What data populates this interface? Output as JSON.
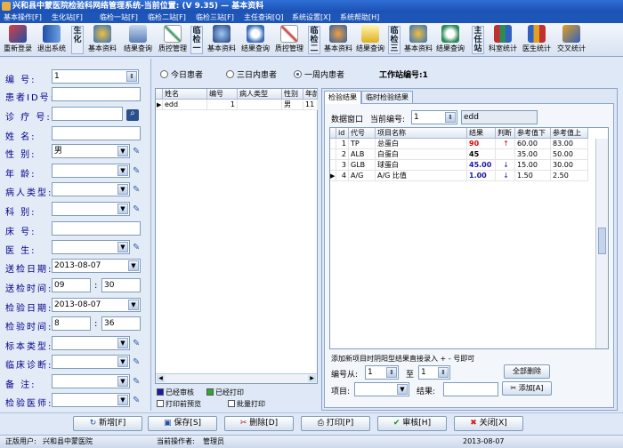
{
  "window": {
    "title": "兴和县中蒙医院检验科网络管理系统-当前位置:  (V 9.35) — 基本资料"
  },
  "menu": [
    "基本操作[F]",
    "生化站[F]",
    "临检一站[F]",
    "临检二站[F]",
    "临检三站[F]",
    "主任查询[Q]",
    "系统设置[X]",
    "系统帮助[H]"
  ],
  "toolbar": {
    "items": [
      "重新登录",
      "退出系统",
      "基本资料",
      "结果查询",
      "质控管理",
      "基本资料",
      "结果查询",
      "质控管理",
      "基本资料",
      "结果查询",
      "基本资料",
      "结果查询",
      "科室统计",
      "医生统计",
      "交叉统计"
    ],
    "vlabels": [
      "生化",
      "临检一",
      "临检二",
      "临检三",
      "主任站"
    ]
  },
  "form": {
    "fields": [
      {
        "label": "编  号:",
        "value": "1"
      },
      {
        "label": "患者ID号:",
        "value": ""
      },
      {
        "label": "诊 疗 号:",
        "value": ""
      },
      {
        "label": "姓   名:",
        "value": ""
      },
      {
        "label": "性   别:",
        "value": "男"
      },
      {
        "label": "年   龄:",
        "value": ""
      },
      {
        "label": "病人类型:",
        "value": ""
      },
      {
        "label": "科   别:",
        "value": ""
      },
      {
        "label": "床   号:",
        "value": ""
      },
      {
        "label": "医   生:",
        "value": ""
      },
      {
        "label": "送检日期:",
        "value": "2013-08-07"
      },
      {
        "label": "送检时间:",
        "value": "09",
        "value2": "30"
      },
      {
        "label": "检验日期:",
        "value": "2013-08-07"
      },
      {
        "label": "检验时间:",
        "value": "8",
        "value2": "36"
      },
      {
        "label": "标本类型:",
        "value": ""
      },
      {
        "label": "临床诊断:",
        "value": ""
      },
      {
        "label": "备   注:",
        "value": ""
      },
      {
        "label": "检验医师:",
        "value": ""
      }
    ]
  },
  "filter": {
    "options": [
      "今日患者",
      "三日内患者",
      "一周内患者"
    ],
    "selected": 2,
    "station_label": "工作站编号:1"
  },
  "patients": {
    "columns": [
      "姓名",
      "编号",
      "病人类型",
      "性别",
      "年龄"
    ],
    "rows": [
      {
        "name": "edd",
        "id": "1",
        "type": "",
        "sex": "男",
        "age": "11"
      }
    ]
  },
  "legend": {
    "reviewed": "已经审核",
    "printed": "已经打印",
    "preview": "打印前预览",
    "batch": "批量打印",
    "reviewed_color": "#1a1aa8",
    "printed_color": "#2fa82f"
  },
  "tabs": [
    "检验结果",
    "临时检验结果"
  ],
  "result": {
    "window_label": "数据窗口",
    "current_label": "当前编号:",
    "current_value": "1",
    "current_name": "edd",
    "columns": [
      "id",
      "代号",
      "项目名称",
      "结果",
      "判断",
      "参考值下",
      "参考值上"
    ],
    "rows": [
      {
        "id": "1",
        "code": "TP",
        "name": "总蛋白",
        "value": "90",
        "flag": "↑",
        "low": "60.00",
        "high": "83.00"
      },
      {
        "id": "2",
        "code": "ALB",
        "name": "白蛋白",
        "value": "45",
        "flag": "",
        "low": "35.00",
        "high": "50.00"
      },
      {
        "id": "3",
        "code": "GLB",
        "name": "球蛋白",
        "value": "45.00",
        "flag": "↓",
        "low": "15.00",
        "high": "30.00"
      },
      {
        "id": "4",
        "code": "A/G",
        "name": "A/G 比值",
        "value": "1.00",
        "flag": "↓",
        "low": "1.50",
        "high": "2.50"
      }
    ],
    "hint": "添加新项目时阴阳型结果直接录入 + - 号即可",
    "from_label": "编号从:",
    "from_value": "1",
    "to_label": "至",
    "to_value": "1",
    "delete_all": "全部删除",
    "item_label": "项目:",
    "result_label": "结果:",
    "add_label": "添加[A]"
  },
  "actions": [
    "新增[F]",
    "保存[S]",
    "删除[D]",
    "打印[P]",
    "审核[H]",
    "关闭[X]"
  ],
  "status": {
    "unit_label": "正版用户:",
    "unit": "兴和县中蒙医院",
    "operator_label": "当前操作者:",
    "operator": "管理员",
    "date": "2013-08-07"
  }
}
